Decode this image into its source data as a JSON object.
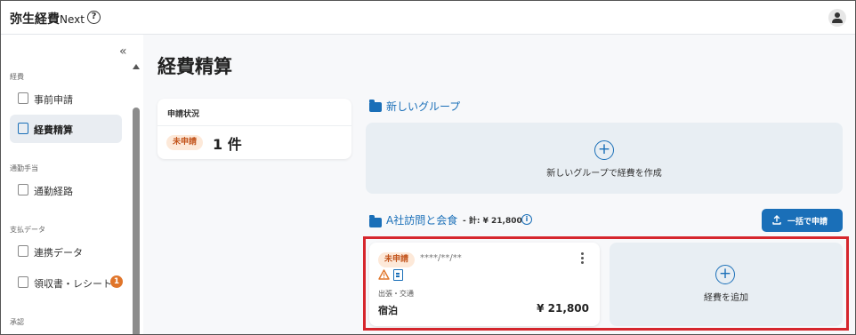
{
  "header": {
    "app_title": "弥生経費",
    "app_suffix": "Next",
    "help_glyph": "?"
  },
  "sidebar": {
    "collapse_glyph": "«",
    "sections": [
      {
        "label": "経費",
        "items": [
          {
            "label": "事前申請",
            "icon": "document-icon"
          },
          {
            "label": "経費精算",
            "icon": "yen-receipt-icon",
            "active": true
          }
        ]
      },
      {
        "label": "通勤手当",
        "items": [
          {
            "label": "通勤経路",
            "icon": "walking-icon"
          }
        ]
      },
      {
        "label": "支払データ",
        "items": [
          {
            "label": "連携データ",
            "icon": "data-icon"
          },
          {
            "label": "領収書・レシート",
            "icon": "receipt-icon",
            "badge": "1"
          }
        ]
      },
      {
        "label": "承認"
      }
    ]
  },
  "main": {
    "page_title": "経費精算",
    "status_card": {
      "title": "申請状況",
      "chip": "未申請",
      "count": "1 件"
    },
    "groups": [
      {
        "name": "新しいグループ",
        "create_label": "新しいグループで経費を作成",
        "plus_glyph": "+"
      },
      {
        "name": "A社訪問と会食",
        "total": "- 計: ¥ 21,800",
        "info_glyph": "i",
        "bulk_button": "一括で申請",
        "expense": {
          "chip": "未申請",
          "date": "****/**/**",
          "category": "出張・交通",
          "name": "宿泊",
          "amount": "¥ 21,800"
        },
        "add_label": "経費を追加",
        "plus_glyph": "+"
      }
    ]
  },
  "colors": {
    "accent": "#1a6fb8",
    "chip_bg": "#fde9d9",
    "chip_text": "#c2531a",
    "badge": "#e0752a",
    "highlight": "#d6262d"
  }
}
